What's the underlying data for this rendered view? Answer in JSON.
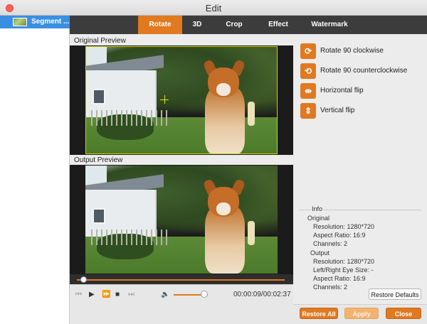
{
  "window": {
    "title": "Edit"
  },
  "sidebar": {
    "items": [
      {
        "label": "Segment ..."
      }
    ]
  },
  "tabs": [
    {
      "label": "Rotate",
      "active": true
    },
    {
      "label": "3D",
      "active": false
    },
    {
      "label": "Crop",
      "active": false
    },
    {
      "label": "Effect",
      "active": false
    },
    {
      "label": "Watermark",
      "active": false
    }
  ],
  "preview": {
    "original_label": "Original Preview",
    "output_label": "Output Preview",
    "timecode": "00:00:09/00:02:37",
    "playback_progress_fraction": 0.03,
    "volume_fraction": 0.9
  },
  "rotate_options": [
    {
      "label": "Rotate 90 clockwise",
      "icon": "rotate-cw-icon",
      "glyph": "⟳"
    },
    {
      "label": "Rotate 90 counterclockwise",
      "icon": "rotate-ccw-icon",
      "glyph": "⟲"
    },
    {
      "label": "Horizontal flip",
      "icon": "flip-horizontal-icon",
      "glyph": "⇹"
    },
    {
      "label": "Vertical flip",
      "icon": "flip-vertical-icon",
      "glyph": "⇕"
    }
  ],
  "info": {
    "title": "Info",
    "original": {
      "heading": "Original",
      "resolution": "Resolution: 1280*720",
      "aspect_ratio": "Aspect Ratio: 16:9",
      "channels": "Channels: 2"
    },
    "output": {
      "heading": "Output",
      "resolution": "Resolution: 1280*720",
      "eye_size": "Left/Right Eye Size: -",
      "aspect_ratio": "Aspect Ratio: 16:9",
      "channels": "Channels: 2"
    }
  },
  "buttons": {
    "restore_defaults": "Restore Defaults",
    "restore_all": "Restore All",
    "apply": "Apply",
    "close": "Close"
  },
  "colors": {
    "accent": "#e0791f",
    "selection": "#3a8fe3",
    "close_dot": "#fc5f57"
  }
}
